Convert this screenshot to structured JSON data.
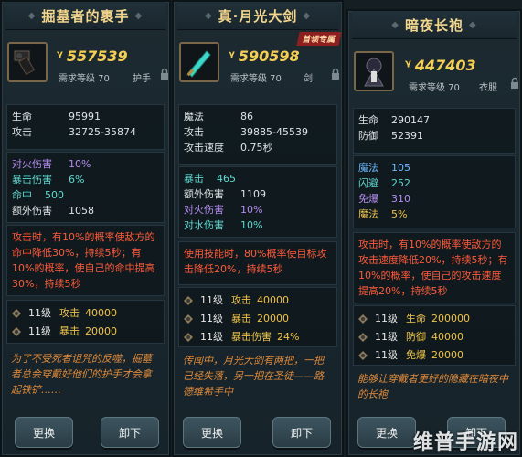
{
  "panels": [
    {
      "title": "掘墓者的裹手",
      "power": "557539",
      "req": "需求等级 70",
      "slot": "护手",
      "stats": [
        {
          "k": "生命",
          "v": "95991"
        },
        {
          "k": "攻击",
          "v": "32725-35874"
        }
      ],
      "extra": [
        {
          "k": "对火伤害",
          "v": "10%"
        },
        {
          "k": "暴击伤害",
          "v": "6%"
        },
        {
          "k": "命中",
          "v": "500"
        },
        {
          "k": "额外伤害",
          "v": "1058"
        }
      ],
      "effect": "攻击时，有10%的概率使敌方的命中降低30%，持续5秒；有10%的概率，使自己的命中提高30%，持续5秒",
      "levels": [
        {
          "lv": "11级",
          "stat": "攻击",
          "val": "40000"
        },
        {
          "lv": "11级",
          "stat": "暴击",
          "val": "20000"
        }
      ],
      "lore": "为了不受死者诅咒的反噬，掘墓者总会穿戴好他们的护手才会拿起铁铲……",
      "btn_swap": "更换",
      "btn_remove": "卸下"
    },
    {
      "title": "真·月光大剑",
      "badge": "首领专属",
      "power": "590598",
      "req": "需求等级 70",
      "slot": "剑",
      "stats": [
        {
          "k": "魔法",
          "v": "86"
        },
        {
          "k": "攻击",
          "v": "39885-45539"
        },
        {
          "k": "攻击速度",
          "v": "0.75秒"
        }
      ],
      "extra": [
        {
          "k": "暴击",
          "v": "465"
        },
        {
          "k": "额外伤害",
          "v": "1109"
        },
        {
          "k": "对火伤害",
          "v": "10%"
        },
        {
          "k": "对水伤害",
          "v": "10%"
        }
      ],
      "effect": "使用技能时，80%概率使目标攻击降低20%，持续5秒",
      "levels": [
        {
          "lv": "11级",
          "stat": "攻击",
          "val": "40000"
        },
        {
          "lv": "11级",
          "stat": "暴击",
          "val": "20000"
        },
        {
          "lv": "11级",
          "stat": "暴击伤害",
          "val": "24%"
        }
      ],
      "lore": "传闻中，月光大剑有两把，一把已经失落，另一把在圣徒——路德维希手中",
      "btn_swap": "更换",
      "btn_remove": "卸下"
    },
    {
      "title": "暗夜长袍",
      "power": "447403",
      "req": "需求等级 70",
      "slot": "衣服",
      "stats": [
        {
          "k": "生命",
          "v": "290147"
        },
        {
          "k": "防御",
          "v": "52391"
        }
      ],
      "extra": [
        {
          "k": "魔法",
          "v": "105"
        },
        {
          "k": "闪避",
          "v": "252"
        },
        {
          "k": "免爆",
          "v": "310"
        },
        {
          "k": "魔法",
          "v": "5%"
        }
      ],
      "effect": "攻击时，有10%的概率使敌方的攻击速度降低20%，持续5秒；有10%的概率，使自己的攻击速度提高20%，持续5秒",
      "levels": [
        {
          "lv": "11级",
          "stat": "生命",
          "val": "200000"
        },
        {
          "lv": "11级",
          "stat": "防御",
          "val": "40000"
        },
        {
          "lv": "11级",
          "stat": "免爆",
          "val": "20000"
        }
      ],
      "lore": "能够让穿戴者更好的隐藏在暗夜中的长袍",
      "btn_swap": "更换",
      "btn_remove": "卸下"
    }
  ],
  "watermark": "维普手游网",
  "colors": {
    "power": "#f5cf55",
    "effect": "#ff5a3a",
    "lore": "#e08a3a",
    "title": "#f3d68e"
  }
}
